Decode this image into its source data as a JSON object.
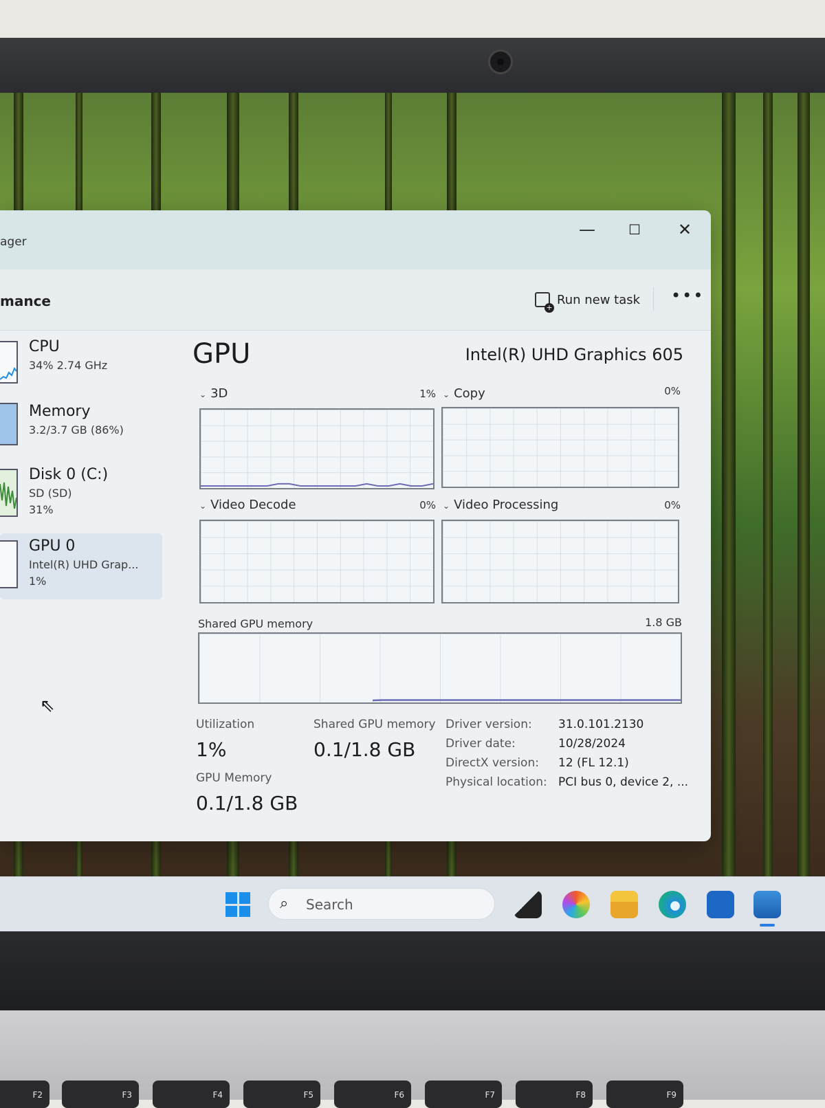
{
  "window": {
    "title": "ager",
    "controls": {
      "minimize": "—",
      "maximize": "☐",
      "close": "✕"
    }
  },
  "commandbar": {
    "page_title": "mance",
    "run_new_task": "Run new task",
    "more": "•••"
  },
  "sidebar": {
    "items": [
      {
        "name": "CPU",
        "sub1": "34%  2.74 GHz",
        "sub2": ""
      },
      {
        "name": "Memory",
        "sub1": "3.2/3.7 GB (86%)",
        "sub2": ""
      },
      {
        "name": "Disk 0 (C:)",
        "sub1": "SD (SD)",
        "sub2": "31%"
      },
      {
        "name": "GPU 0",
        "sub1": "Intel(R) UHD Grap...",
        "sub2": "1%"
      }
    ],
    "selected": "GPU 0"
  },
  "main": {
    "title": "GPU",
    "model": "Intel(R) UHD Graphics 605",
    "engines": [
      {
        "label": "3D",
        "percent": "1%",
        "usage": [
          0,
          0,
          0,
          0,
          0,
          0,
          0,
          1,
          1,
          0,
          0,
          0,
          0,
          0,
          0,
          1,
          0,
          0,
          1,
          0,
          0,
          1
        ]
      },
      {
        "label": "Copy",
        "percent": "0%",
        "usage": []
      },
      {
        "label": "Video Decode",
        "percent": "0%",
        "usage": []
      },
      {
        "label": "Video Processing",
        "percent": "0%",
        "usage": []
      }
    ],
    "shared_graph": {
      "label": "Shared GPU memory",
      "max": "1.8 GB",
      "usage_fraction": 0.05
    },
    "stats": {
      "utilization_label": "Utilization",
      "utilization_value": "1%",
      "shared_label": "Shared GPU memory",
      "shared_value": "0.1/1.8 GB",
      "gpu_mem_label": "GPU Memory",
      "gpu_mem_value": "0.1/1.8 GB"
    },
    "properties": [
      {
        "key": "Driver version:",
        "value": "31.0.101.2130"
      },
      {
        "key": "Driver date:",
        "value": "10/28/2024"
      },
      {
        "key": "DirectX version:",
        "value": "12 (FL 12.1)"
      },
      {
        "key": "Physical location:",
        "value": "PCI bus 0, device 2, ..."
      }
    ]
  },
  "taskbar": {
    "search_placeholder": "Search",
    "apps": [
      "windows-start",
      "task-view",
      "copilot",
      "file-explorer",
      "edge",
      "microsoft-store",
      "task-manager"
    ]
  },
  "keyboard": {
    "keys": [
      "F2",
      "F3",
      "F4",
      "F5",
      "F6",
      "F7",
      "F8",
      "F9"
    ]
  },
  "colors": {
    "accent": "#1a8ee8",
    "graph_line": "#6b6bb8",
    "sidebar_selected": "#dce4ee"
  }
}
